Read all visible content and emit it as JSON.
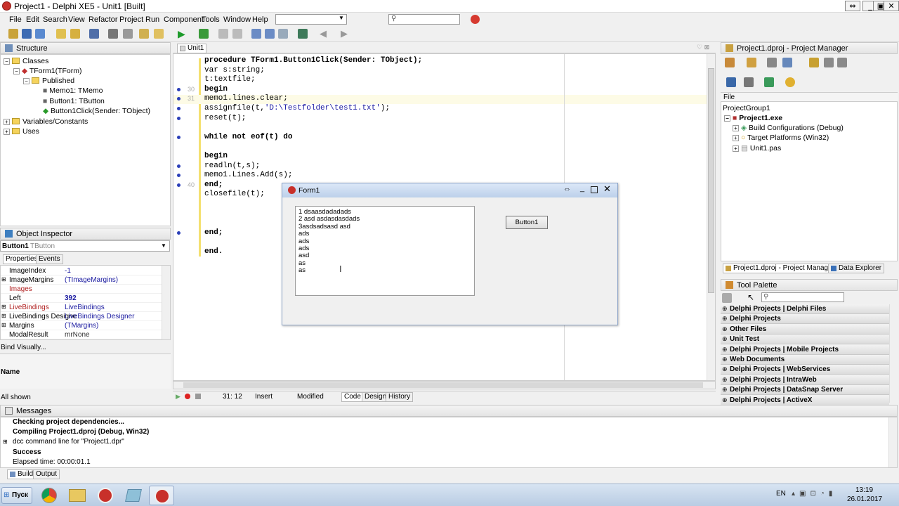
{
  "window": {
    "title": "Project1 - Delphi XE5 - Unit1 [Built]"
  },
  "window_controls": {
    "restore_alt": "⇔",
    "minimize": "_",
    "maximize": "▣",
    "close": "✕"
  },
  "menu": [
    "File",
    "Edit",
    "Search",
    "View",
    "Refactor",
    "Project",
    "Run",
    "Component",
    "Tools",
    "Window",
    "Help"
  ],
  "structure": {
    "title": "Structure",
    "items": [
      "Classes",
      "TForm1(TForm)",
      "Published",
      "Memo1: TMemo",
      "Button1: TButton",
      "Button1Click(Sender: TObject)",
      "Variables/Constants",
      "Uses"
    ]
  },
  "editor": {
    "tab": "Unit1",
    "lines": [
      {
        "num": "",
        "text": "procedure TForm1.Button1Click(Sender: TObject);"
      },
      {
        "num": "",
        "text": "var s:string;"
      },
      {
        "num": "",
        "text": "t:textfile;"
      },
      {
        "num": "30",
        "text": "begin"
      },
      {
        "num": "31",
        "text": "memo1.lines.clear;"
      },
      {
        "num": "",
        "text": "assignfile(t,'D:\\Testfolder\\test1.txt');"
      },
      {
        "num": "",
        "text": "reset(t);"
      },
      {
        "num": "",
        "text": ""
      },
      {
        "num": "",
        "text": "while not eof(t) do"
      },
      {
        "num": "",
        "text": ""
      },
      {
        "num": "",
        "text": "begin"
      },
      {
        "num": "",
        "text": "readln(t,s);"
      },
      {
        "num": "",
        "text": "memo1.Lines.Add(s);"
      },
      {
        "num": "40",
        "text": "end;"
      },
      {
        "num": "",
        "text": "closefile(t);"
      },
      {
        "num": "",
        "text": ""
      },
      {
        "num": "",
        "text": ""
      },
      {
        "num": "",
        "text": ""
      },
      {
        "num": "",
        "text": "end;"
      },
      {
        "num": "",
        "text": ""
      },
      {
        "num": "",
        "text": "end."
      }
    ]
  },
  "form1": {
    "title": "Form1",
    "memo_lines": [
      "1 dsaasdadadads",
      "2 asd asdasdasdads",
      "3asdsadsasd asd",
      "ads",
      "ads",
      "ads",
      "asd",
      "as",
      "as"
    ],
    "button": "Button1"
  },
  "object_inspector": {
    "title": "Object Inspector",
    "selected": "Button1",
    "selected_type": "TButton",
    "tabs": [
      "Properties",
      "Events"
    ],
    "rows": [
      {
        "k": "ImageIndex",
        "v": "-1"
      },
      {
        "k": "ImageMargins",
        "v": "(TImageMargins)"
      },
      {
        "k": "Images",
        "v": ""
      },
      {
        "k": "Left",
        "v": "392"
      },
      {
        "k": "LiveBindings",
        "v": "LiveBindings"
      },
      {
        "k": "LiveBindings Designe",
        "v": "LiveBindings Designer"
      },
      {
        "k": "Margins",
        "v": "(TMargins)"
      },
      {
        "k": "ModalResult",
        "v": "mrNone"
      }
    ],
    "bind_visually": "Bind Visually...",
    "name_label": "Name",
    "all_shown": "All shown"
  },
  "status": {
    "position": "31: 12",
    "mode": "Insert",
    "state": "Modified",
    "tabs": [
      "Code",
      "Design",
      "History"
    ]
  },
  "project_manager": {
    "title": "Project1.dproj - Project Manager",
    "file_label": "File",
    "items": [
      "ProjectGroup1",
      "Project1.exe",
      "Build Configurations (Debug)",
      "Target Platforms (Win32)",
      "Unit1.pas"
    ],
    "bottom_tabs": [
      "Project1.dproj - Project Manager",
      "Data Explorer"
    ]
  },
  "tool_palette": {
    "title": "Tool Palette",
    "categories": [
      "Delphi Projects | Delphi Files",
      "Delphi Projects",
      "Other Files",
      "Unit Test",
      "Delphi Projects | Mobile Projects",
      "Web Documents",
      "Delphi Projects | WebServices",
      "Delphi Projects | IntraWeb",
      "Delphi Projects | DataSnap Server",
      "Delphi Projects | ActiveX"
    ]
  },
  "messages": {
    "title": "Messages",
    "lines": [
      "Checking project dependencies...",
      "Compiling Project1.dproj (Debug, Win32)",
      "dcc command line for \"Project1.dpr\"",
      "Success",
      "Elapsed time: 00:00:01.1"
    ],
    "tabs": [
      "Build",
      "Output"
    ]
  },
  "taskbar": {
    "start": "Пуск",
    "lang": "EN",
    "time": "13:19",
    "date": "26.01.2017"
  }
}
